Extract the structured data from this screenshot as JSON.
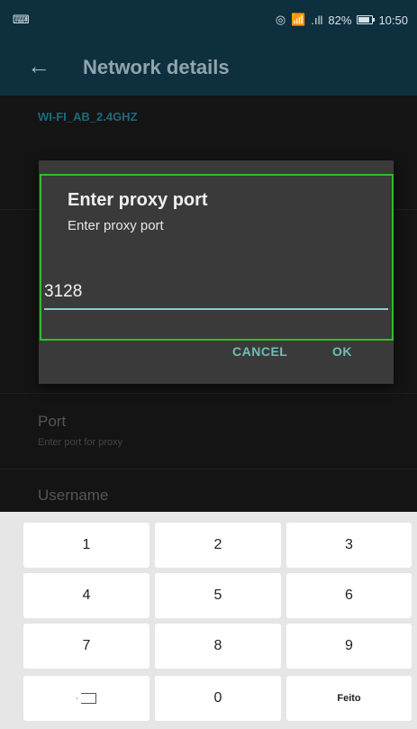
{
  "status_bar": {
    "keyboard_icon": "keyboard-icon",
    "sync_icon": "sync-icon",
    "wifi_icon": "wifi-icon",
    "signal": ".ıll",
    "battery_text": "82%",
    "time": "10:50"
  },
  "app_bar": {
    "back_icon": "back-arrow-icon",
    "title": "Network details"
  },
  "background": {
    "ssid": "WI-FI_AB_2.4GHZ",
    "port_label": "Port",
    "port_sub": "Enter port for proxy",
    "username_label": "Username"
  },
  "dialog": {
    "title": "Enter proxy port",
    "message": "Enter proxy port",
    "input_value": "3128",
    "cancel_label": "CANCEL",
    "ok_label": "OK"
  },
  "keypad": {
    "keys": [
      "1",
      "2",
      "3",
      "4",
      "5",
      "6",
      "7",
      "8",
      "9",
      "0"
    ],
    "done_label": "Feito",
    "backspace_icon": "backspace-icon"
  },
  "colors": {
    "accent": "#6dbfb8",
    "focus_outline": "#2ebd2e",
    "app_bar": "#0e2f3d",
    "dialog_bg": "#3a3a3a"
  }
}
